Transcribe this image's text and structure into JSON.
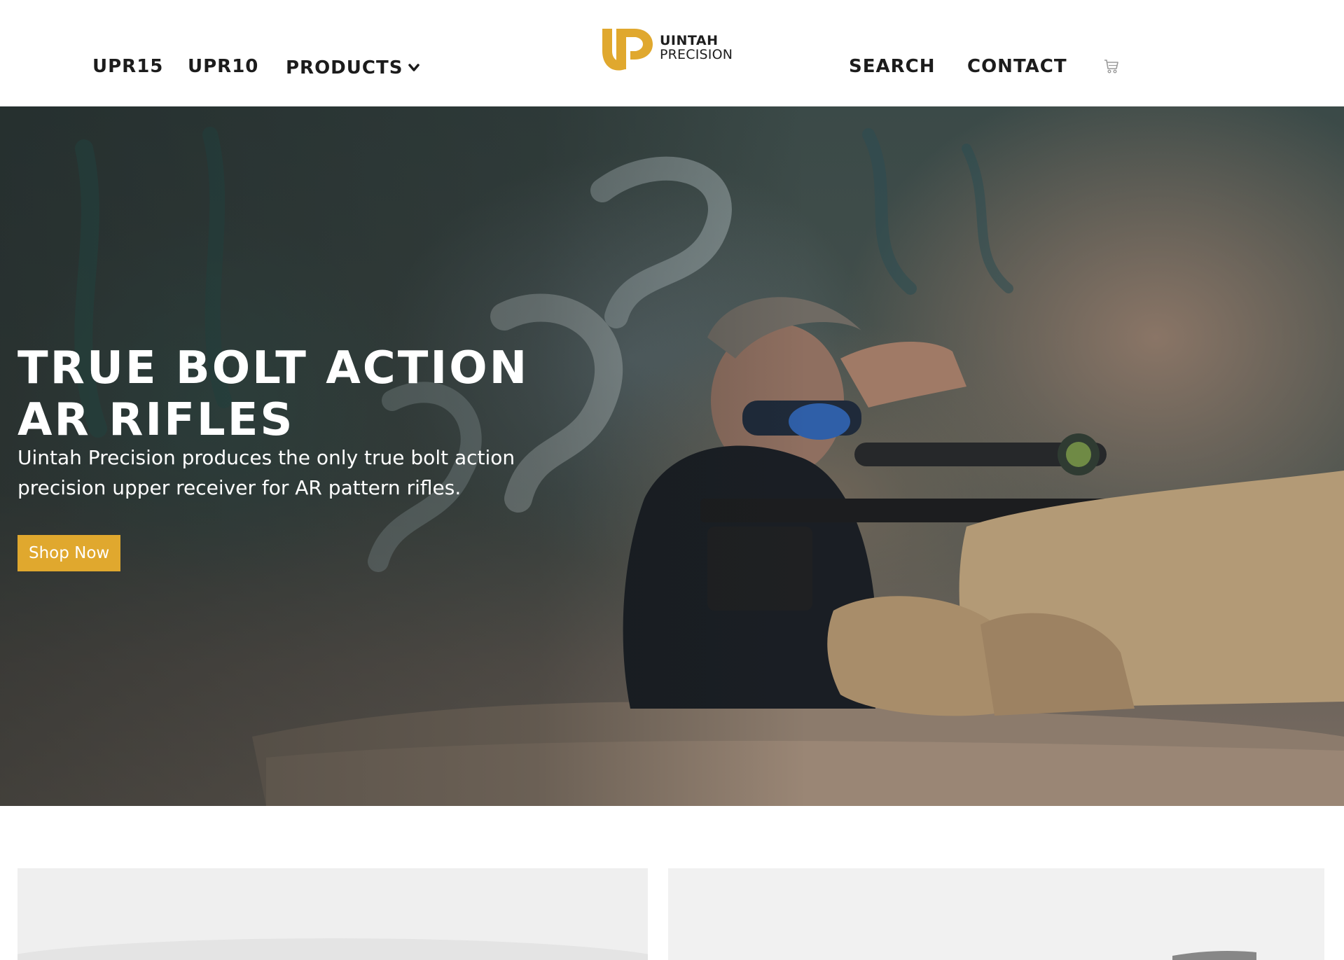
{
  "header": {
    "nav_left": [
      {
        "label": "UPR15"
      },
      {
        "label": "UPR10"
      },
      {
        "label": "PRODUCTS"
      }
    ],
    "logo": {
      "line1": "UINTAH",
      "line2": "PRECISION"
    },
    "nav_right": [
      {
        "label": "SEARCH"
      },
      {
        "label": "CONTACT"
      }
    ]
  },
  "hero": {
    "title": "TRUE BOLT ACTION AR RIFLES",
    "subtitle": "Uintah Precision produces the only true bolt action precision upper receiver for AR pattern rifles.",
    "cta_label": "Shop Now"
  },
  "colors": {
    "brand_gold": "#e0a82e",
    "nav_text": "#1c1c1c",
    "hero_text": "#ffffff"
  },
  "icons": {
    "products_dropdown": "chevron-down-icon",
    "cart": "cart-icon"
  }
}
